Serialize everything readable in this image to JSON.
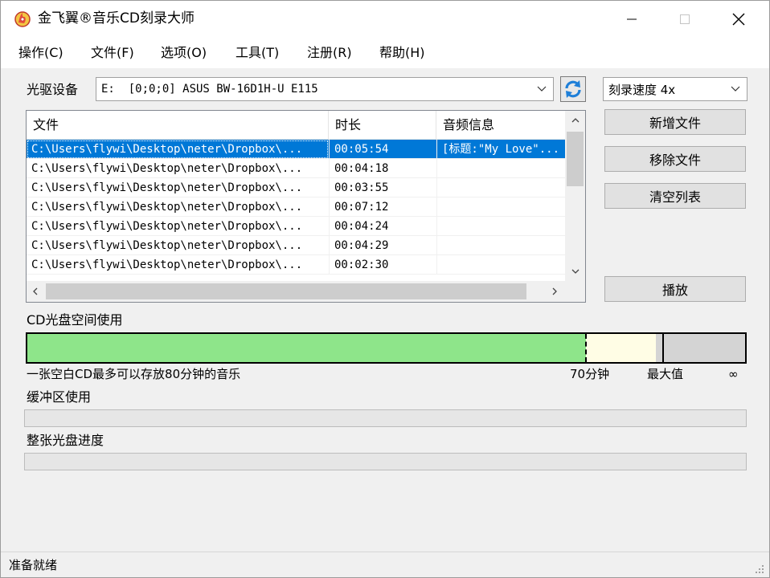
{
  "window": {
    "title": "金飞翼®音乐CD刻录大师",
    "icon": "flame-disc-icon",
    "controls": [
      "minimize-icon",
      "maximize-icon",
      "close-icon"
    ]
  },
  "menu": [
    "操作(C)",
    "文件(F)",
    "选项(O)",
    "工具(T)",
    "注册(R)",
    "帮助(H)"
  ],
  "drive": {
    "label": "光驱设备",
    "selected": "E:  [0;0;0] ASUS BW-16D1H-U E115"
  },
  "speed": {
    "selected": "刻录速度 4x"
  },
  "file_list": {
    "columns": [
      "文件",
      "时长",
      "音频信息"
    ],
    "rows": [
      {
        "file": "C:\\Users\\flywi\\Desktop\\neter\\Dropbox\\...",
        "duration": "00:05:54",
        "info": "[标题:\"My Love\"..."
      },
      {
        "file": "C:\\Users\\flywi\\Desktop\\neter\\Dropbox\\...",
        "duration": "00:04:18",
        "info": ""
      },
      {
        "file": "C:\\Users\\flywi\\Desktop\\neter\\Dropbox\\...",
        "duration": "00:03:55",
        "info": ""
      },
      {
        "file": "C:\\Users\\flywi\\Desktop\\neter\\Dropbox\\...",
        "duration": "00:07:12",
        "info": ""
      },
      {
        "file": "C:\\Users\\flywi\\Desktop\\neter\\Dropbox\\...",
        "duration": "00:04:24",
        "info": ""
      },
      {
        "file": "C:\\Users\\flywi\\Desktop\\neter\\Dropbox\\...",
        "duration": "00:04:29",
        "info": ""
      },
      {
        "file": "C:\\Users\\flywi\\Desktop\\neter\\Dropbox\\...",
        "duration": "00:02:30",
        "info": ""
      }
    ],
    "selected_index": 0
  },
  "buttons": {
    "add_file": "新增文件",
    "remove_file": "移除文件",
    "clear_list": "清空列表",
    "play": "播放"
  },
  "cd_usage": {
    "label": "CD光盘空间使用",
    "caption": "一张空白CD最多可以存放80分钟的音乐",
    "mark_70": "70分钟",
    "mark_max": "最大值",
    "mark_infinity": "∞",
    "used_minutes": 70,
    "max_minutes": 80,
    "colors": {
      "used": "#8ee58a",
      "free": "#fffde5",
      "over": "#d4d4d4"
    }
  },
  "buffer": {
    "label": "缓冲区使用",
    "progress": 0
  },
  "disc_progress": {
    "label": "整张光盘进度",
    "progress": 0
  },
  "status": {
    "text": "准备就绪"
  },
  "colors": {
    "selection": "#0078d7",
    "refresh_icon": "#1e7fd8"
  }
}
